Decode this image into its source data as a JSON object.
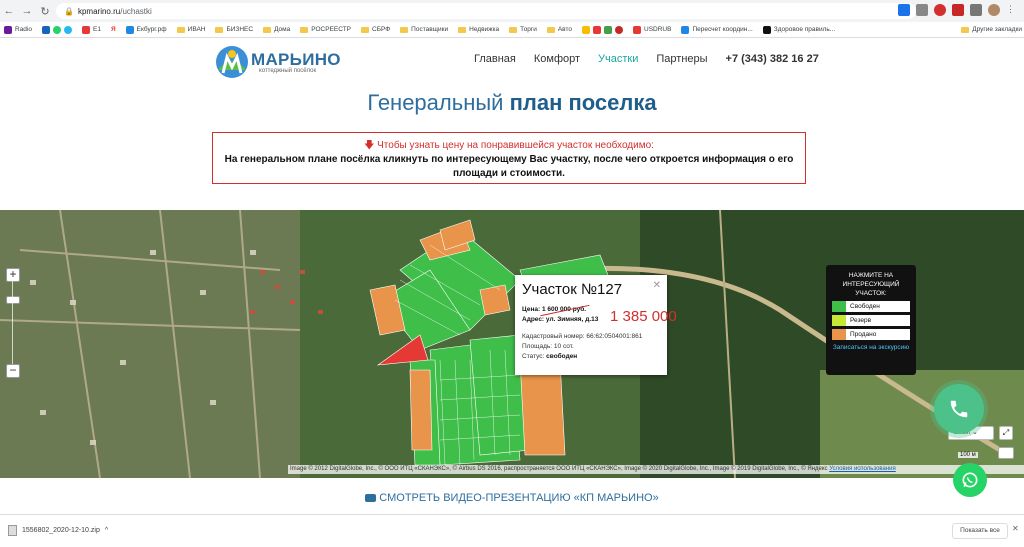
{
  "browser": {
    "url_host": "kpmarino.ru",
    "url_path": "/uchastki",
    "bookmarks": [
      "Radio",
      "E1",
      "Я",
      "Екбург.рф",
      "ИВАН",
      "БИЗНЕС",
      "Дома",
      "РОСРЕЕСТР",
      "СБРФ",
      "Поставщики",
      "Недвижка",
      "Торги",
      "Авто",
      "USDRUB",
      "Пересчет координ...",
      "Здоровое правиль...",
      "Другие закладки"
    ]
  },
  "site": {
    "logo_title": "МАРЬИНО",
    "logo_subtitle": "коттеджный посёлок",
    "nav": [
      "Главная",
      "Комфорт",
      "Участки",
      "Партнеры"
    ],
    "phone": "+7 (343) 382 16 27"
  },
  "page": {
    "title_light": "Генеральный",
    "title_bold": "план поселка",
    "notice_red": "Чтобы узнать цену на понравившейся участок необходимо:",
    "notice_line2": "На генеральном плане посёлка кликнуть по интересующему Вас участку, после чего откроется информация о его",
    "notice_line3": "площади и стоимости."
  },
  "map": {
    "layers_label": "Слои",
    "popup": {
      "title": "Участок №127",
      "price_label": "Цена:",
      "price_value": "1 600 000 руб.",
      "address_label": "Адрес:",
      "address_value": "ул. Зимняя, д.13",
      "cadastral": "Кадастровый номер: 66:62:0504001:861",
      "area": "Площадь: 10 сот.",
      "status_label": "Статус:",
      "status_value": "свободен"
    },
    "new_price": "1 385 000",
    "legend": {
      "heading": "НАЖМИТЕ НА ИНТЕРЕСУЮЩИЙ УЧАСТОК:",
      "items": [
        {
          "label": "Свободен",
          "color": "#3fbf4a"
        },
        {
          "label": "Резерв",
          "color": "#c6e835"
        },
        {
          "label": "Продано",
          "color": "#e8944a"
        }
      ],
      "link": "Записаться на экскурсию"
    },
    "scale": "100 м",
    "copyright": "Image © 2012 DigitalGlobe, Inc., © ООО ИТЦ «СКАНЭКС», © Airbus DS 2016, распространяется ООО ИТЦ «СКАНЭКС», Image © 2020 DigitalGlobe, Inc., Image © 2019 DigitalGlobe, Inc., © Яндекс",
    "terms": "Условия использования"
  },
  "video_link": "СМОТРЕТЬ ВИДЕО-ПРЕЗЕНТАЦИЮ «КП МАРЬИНО»",
  "downloads": {
    "file": "1556802_2020-12-10.zip",
    "show_all": "Показать все"
  }
}
